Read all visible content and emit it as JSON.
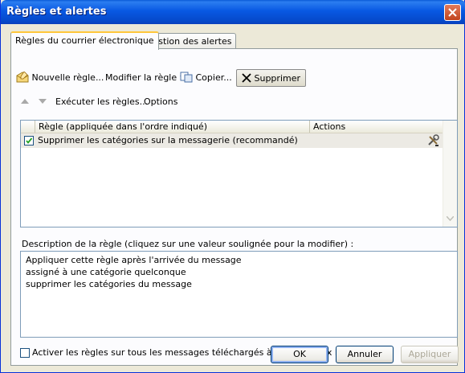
{
  "window": {
    "title": "Règles et alertes"
  },
  "tabs": [
    {
      "label": "Règles du courrier électronique"
    },
    {
      "label": "Gestion des alertes"
    }
  ],
  "toolbar": {
    "new_rule": "Nouvelle règle...",
    "modify_rule": "Modifier la règle",
    "copy": "Copier...",
    "delete": "Supprimer",
    "run_rules": "Exécuter les règles...",
    "options": "Options"
  },
  "rules_table": {
    "columns": [
      "Règle (appliquée dans l'ordre indiqué)",
      "Actions"
    ],
    "rows": [
      {
        "checked": true,
        "name": "Supprimer les catégories sur la messagerie (recommandé)",
        "action_icon": "rule-actions-icon"
      }
    ]
  },
  "description": {
    "label": "Description de la règle (cliquez sur une valeur soulignée pour la modifier) :",
    "lines": [
      "Appliquer cette règle après l'arrivée du message",
      "assigné à une catégorie quelconque",
      "supprimer les catégories du message"
    ]
  },
  "rss": {
    "checked": false,
    "label": "Activer les règles sur tous les messages téléchargés à partir de flux RSS"
  },
  "buttons": {
    "ok": "OK",
    "cancel": "Annuler",
    "apply": "Appliquer"
  }
}
